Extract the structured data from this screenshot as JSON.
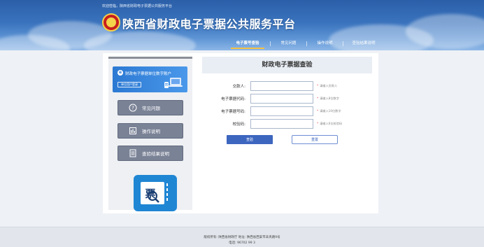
{
  "header": {
    "welcome": "欢迎莅临，陕西省财政电子票据公共服务平台",
    "site_title": "陕西省财政电子票据公共服务平台",
    "logo_icon": "national-emblem-icon"
  },
  "nav": {
    "items": [
      {
        "label": "电子票号查验",
        "active": true
      },
      {
        "label": "常见问题",
        "active": false
      },
      {
        "label": "操作说明",
        "active": false
      },
      {
        "label": "查验结果说明",
        "active": false
      }
    ]
  },
  "sidebar": {
    "promo": {
      "title": "财政电子票据单位数字账户",
      "button": "单位用户登录",
      "icon": "account-icon"
    },
    "buttons": [
      {
        "label": "常见问题",
        "icon": "question-circle-icon"
      },
      {
        "label": "操作说明",
        "icon": "instruction-icon"
      },
      {
        "label": "查验结果说明",
        "icon": "document-icon"
      }
    ],
    "ticket_icon": {
      "glyph": "票",
      "icon": "ticket-search-icon"
    }
  },
  "form": {
    "title": "财政电子票据查验",
    "fields": [
      {
        "label": "交款人:",
        "value": "",
        "hint": "请输入交款人"
      },
      {
        "label": "电子票据代码:",
        "value": "",
        "hint": "请输入8位数字"
      },
      {
        "label": "电子票据号码:",
        "value": "",
        "hint": "请输入10位数字"
      },
      {
        "label": "校验码:",
        "value": "",
        "hint": "请输入6位校验码"
      }
    ],
    "required_mark": "*",
    "query_label": "查验",
    "reset_label": "重置"
  },
  "footer": {
    "copyright": "版权所有: 陕西省财政厅    地址: 陕西省西安市未央路9号",
    "phone": "电话: 96702 99 3"
  },
  "colors": {
    "header_blue": "#3a73bd",
    "accent_yellow": "#f5c242",
    "side_button": "#7a8296",
    "query_button": "#3d66bf",
    "required_red": "#e03a3a"
  }
}
